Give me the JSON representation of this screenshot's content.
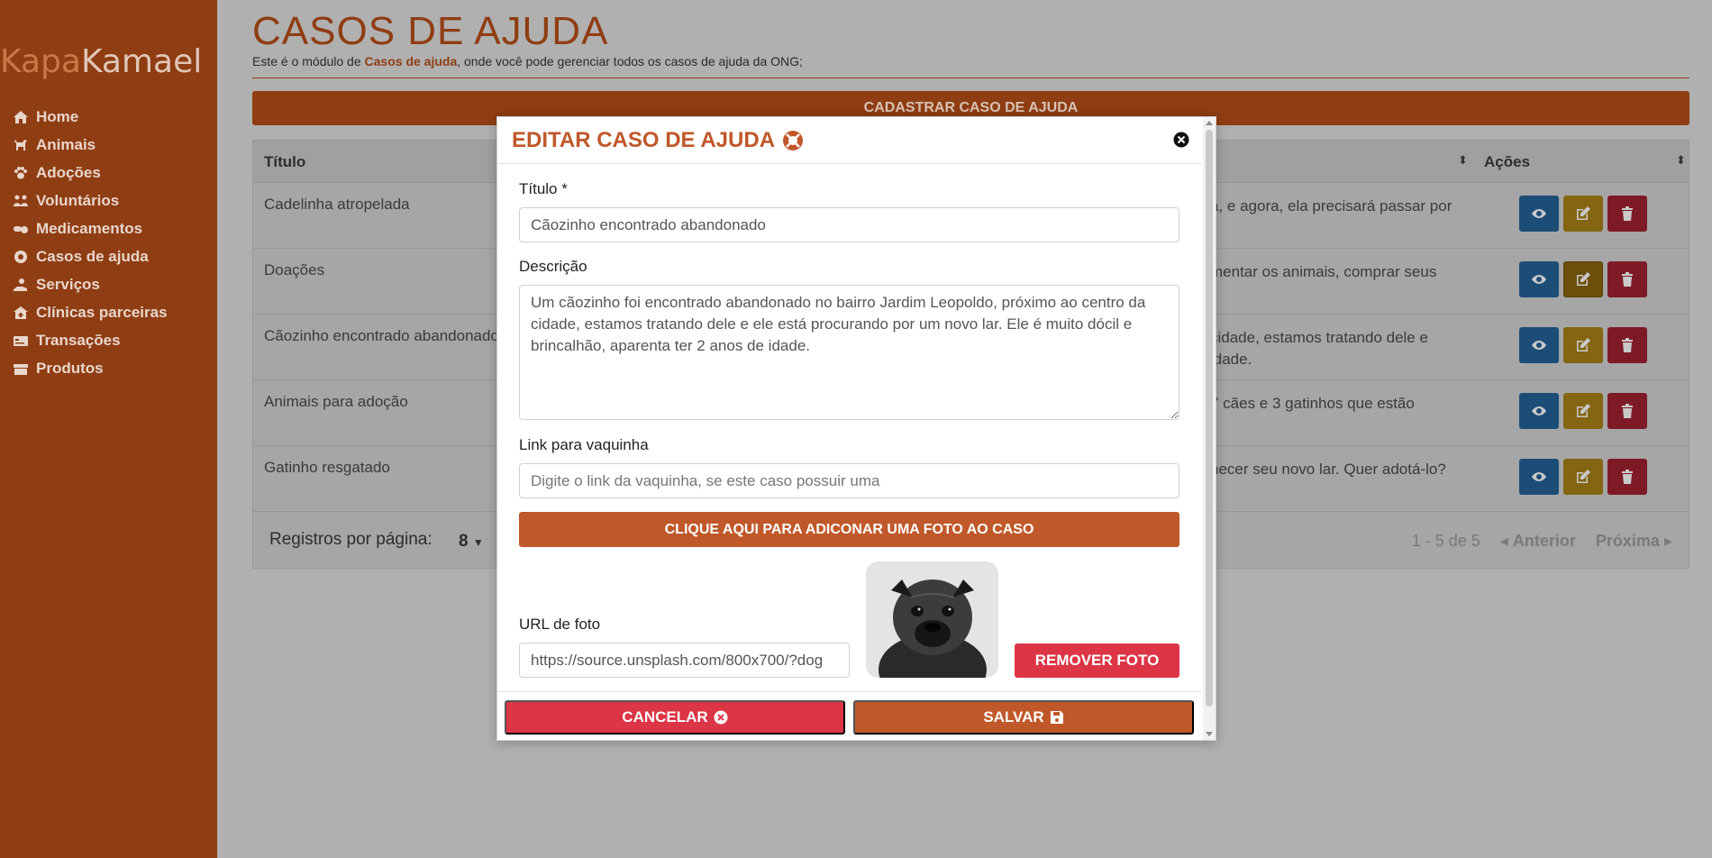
{
  "sidebar": {
    "brand_part1": "Kapa",
    "brand_part2": "Kamael",
    "items": [
      {
        "label": "Home",
        "icon": "home-icon"
      },
      {
        "label": "Animais",
        "icon": "dog-icon"
      },
      {
        "label": "Adoções",
        "icon": "paw-icon"
      },
      {
        "label": "Voluntários",
        "icon": "people-icon"
      },
      {
        "label": "Medicamentos",
        "icon": "pills-icon"
      },
      {
        "label": "Casos de ajuda",
        "icon": "life-ring-icon"
      },
      {
        "label": "Serviços",
        "icon": "hand-icon"
      },
      {
        "label": "Clínicas parceiras",
        "icon": "clinic-icon"
      },
      {
        "label": "Transações",
        "icon": "card-icon"
      },
      {
        "label": "Produtos",
        "icon": "boxes-icon"
      }
    ]
  },
  "header": {
    "title": "CASOS DE AJUDA",
    "subtitle_before": "Este é o módulo de ",
    "subtitle_bold": "Casos de ajuda",
    "subtitle_after": ", onde você pode gerenciar todos os casos de ajuda da ONG;",
    "new_button": "CADASTRAR CASO DE AJUDA"
  },
  "table": {
    "columns": [
      "Título",
      "Ações"
    ],
    "rows": [
      {
        "title": "Cadelinha atropelada",
        "desc": "a, e agora, ela precisará passar por"
      },
      {
        "title": "Doações",
        "desc": "mentar os animais, comprar seus"
      },
      {
        "title": "Cãozinho encontrado abandonado",
        "desc": "cidade, estamos tratando dele e\nidade."
      },
      {
        "title": "Animais para adoção",
        "desc": "7 cães e 3 gatinhos que estão"
      },
      {
        "title": "Gatinho resgatado",
        "desc": "hecer seu novo lar. Quer adotá-lo?"
      }
    ],
    "per_page_label": "Registros por página:",
    "per_page_value": "8",
    "range": "1 - 5 de 5",
    "prev": "Anterior",
    "next": "Próxima"
  },
  "modal": {
    "title": "EDITAR CASO DE AJUDA",
    "title_label": "Título *",
    "title_value": "Cãozinho encontrado abandonado",
    "desc_label": "Descrição",
    "desc_value": "Um cãozinho foi encontrado abandonado no bairro Jardim Leopoldo, próximo ao centro da cidade, estamos tratando dele e ele está procurando por um novo lar. Ele é muito dócil e brincalhão, aparenta ter 2 anos de idade.",
    "link_label": "Link para vaquinha",
    "link_placeholder": "Digite o link da vaquinha, se este caso possuir uma",
    "photo_button": "CLIQUE AQUI PARA ADICONAR UMA FOTO AO CASO",
    "url_label": "URL de foto",
    "url_value": "https://source.unsplash.com/800x700/?dog",
    "remove_button": "REMOVER FOTO",
    "cancel_button": "CANCELAR",
    "save_button": "SALVAR"
  },
  "colors": {
    "brand": "#8f3d12",
    "accent": "#c0582a",
    "danger": "#dc3545"
  }
}
